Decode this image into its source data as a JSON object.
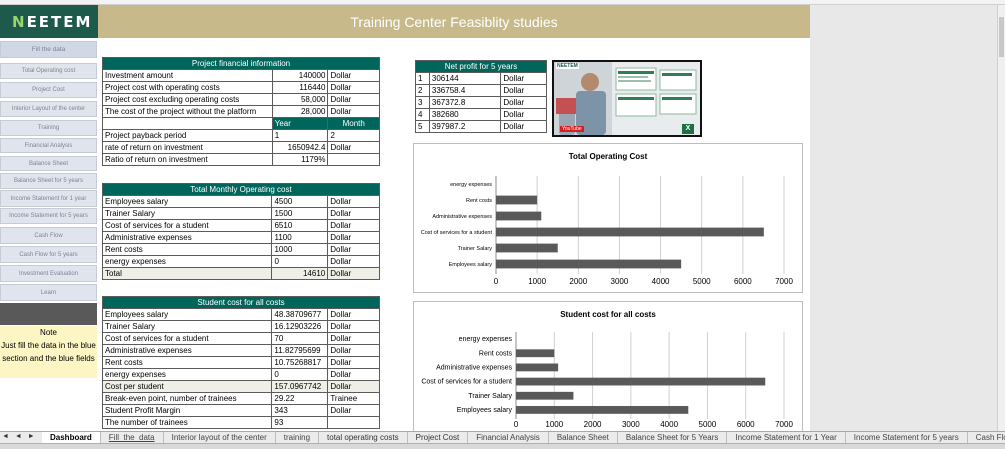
{
  "sidebar": {
    "logo": {
      "first": "N",
      "rest": "EETEM"
    },
    "items": [
      {
        "label": "Fill the data"
      },
      {
        "label": "Total Operating cost"
      },
      {
        "label": "Project Cost"
      },
      {
        "label": "Interior Layout of the center"
      },
      {
        "label": "Training"
      },
      {
        "label": "Financial Analysis"
      },
      {
        "label": "Balance Sheet"
      },
      {
        "label": "Balance Sheet for 5 years"
      },
      {
        "label": "Income Statement for 1 year"
      },
      {
        "label": "Income Statement for 5 years"
      },
      {
        "label": "Cash Flow"
      },
      {
        "label": "Cash Flow for 5 years"
      },
      {
        "label": "Investment Evaluation"
      },
      {
        "label": "Learn"
      }
    ],
    "note_title": "Note",
    "note_text": "Just fill the data in the blue section and the blue fields"
  },
  "header": {
    "title": "Training Center Feasiblity studies"
  },
  "financial": {
    "title": "Project financial information",
    "rows": [
      {
        "label": "Investment amount",
        "value": "140000",
        "unit": "Dollar"
      },
      {
        "label": "Project cost with operating costs",
        "value": "116440",
        "unit": "Dollar"
      },
      {
        "label": "Project cost excluding operating costs",
        "value": "58,000",
        "unit": "Dollar"
      },
      {
        "label": "The cost of the project without the platform",
        "value": "28,000",
        "unit": "Dollar"
      }
    ],
    "year_header": "Year",
    "month_header": "Month",
    "payback_label": "Project payback period",
    "payback_year": "1",
    "payback_month": "2",
    "ror_label": "rate of return on investment",
    "ror_value": "1650942.4",
    "ror_unit": "Dollar",
    "ratio_label": "Ratio of return on investment",
    "ratio_value": "1179%"
  },
  "monthly": {
    "title": "Total Monthly Operating cost",
    "rows": [
      {
        "label": "Employees salary",
        "value": "4500",
        "unit": "Dollar"
      },
      {
        "label": "Trainer Salary",
        "value": "1500",
        "unit": "Dollar"
      },
      {
        "label": "Cost of services for a student",
        "value": "6510",
        "unit": "Dollar"
      },
      {
        "label": "Administrative expenses",
        "value": "1100",
        "unit": "Dollar"
      },
      {
        "label": "Rent costs",
        "value": "1000",
        "unit": "Dollar"
      },
      {
        "label": "energy expenses",
        "value": "0",
        "unit": "Dollar"
      }
    ],
    "total_label": "Total",
    "total_value": "14610",
    "total_unit": "Dollar"
  },
  "student": {
    "title": "Student cost for all costs",
    "rows": [
      {
        "label": "Employees salary",
        "value": "48.38709677",
        "unit": "Dollar"
      },
      {
        "label": "Trainer Salary",
        "value": "16.12903226",
        "unit": "Dollar"
      },
      {
        "label": "Cost of services for a student",
        "value": "70",
        "unit": "Dollar"
      },
      {
        "label": "Administrative expenses",
        "value": "11.82795699",
        "unit": "Dollar"
      },
      {
        "label": "Rent costs",
        "value": "10.75268817",
        "unit": "Dollar"
      },
      {
        "label": "energy expenses",
        "value": "0",
        "unit": "Dollar"
      }
    ],
    "per_student_label": "Cost per student",
    "per_student_value": "157.0967742",
    "per_student_unit": "Dollar",
    "extra": [
      {
        "label": "Break-even point, number of trainees",
        "value": "29.22",
        "unit": "Trainee"
      },
      {
        "label": "Student Profit Margin",
        "value": "343",
        "unit": "Dollar"
      },
      {
        "label": "The number of trainees",
        "value": "93",
        "unit": ""
      }
    ]
  },
  "netprofit": {
    "title": "Net profit for 5 years",
    "rows": [
      {
        "year": "1",
        "value": "306144",
        "unit": "Dollar"
      },
      {
        "year": "2",
        "value": "336758.4",
        "unit": "Dollar"
      },
      {
        "year": "3",
        "value": "367372.8",
        "unit": "Dollar"
      },
      {
        "year": "4",
        "value": "382680",
        "unit": "Dollar"
      },
      {
        "year": "5",
        "value": "397987.2",
        "unit": "Dollar"
      }
    ]
  },
  "video": {
    "logo": "NEETEM",
    "badge": "YouTube",
    "excel_badge": "X"
  },
  "chart_data": [
    {
      "type": "bar",
      "orientation": "horizontal",
      "title": "Total Operating Cost",
      "categories": [
        "energy expenses",
        "Rent costs",
        "Administrative expenses",
        "Cost of services for a student",
        "Trainer Salary",
        "Employees salary"
      ],
      "values": [
        0,
        1000,
        1100,
        6510,
        1500,
        4500
      ],
      "xlim": [
        0,
        7000
      ],
      "xticks": [
        "0",
        "1000",
        "2000",
        "3000",
        "4000",
        "5000",
        "6000",
        "7000"
      ],
      "grid": true,
      "color": "#595959"
    },
    {
      "type": "bar",
      "orientation": "horizontal",
      "title": "Student cost for all costs",
      "categories": [
        "energy expenses",
        "Rent costs",
        "Administrative expenses",
        "Cost of services for a student",
        "Trainer Salary",
        "Employees salary"
      ],
      "values": [
        0,
        1000,
        1100,
        6510,
        1500,
        4500
      ],
      "xlim": [
        0,
        7000
      ],
      "xticks": [
        "0",
        "1000",
        "2000",
        "3000",
        "4000",
        "5000",
        "6000",
        "7000"
      ],
      "grid": true,
      "color": "#595959"
    }
  ],
  "tabs": {
    "nav": "◄ ◄ ► ►",
    "items": [
      {
        "label": "Dashboard"
      },
      {
        "label": "Fill_the_data"
      },
      {
        "label": "Interior layout of the center"
      },
      {
        "label": "training"
      },
      {
        "label": "total operating costs"
      },
      {
        "label": "Project Cost"
      },
      {
        "label": "Financial Analysis"
      },
      {
        "label": "Balance Sheet"
      },
      {
        "label": "Balance Sheet for 5 Years"
      },
      {
        "label": "Income Statement for 1 Year"
      },
      {
        "label": "Income Statement for 5 years"
      },
      {
        "label": "Cash Flo"
      }
    ]
  }
}
